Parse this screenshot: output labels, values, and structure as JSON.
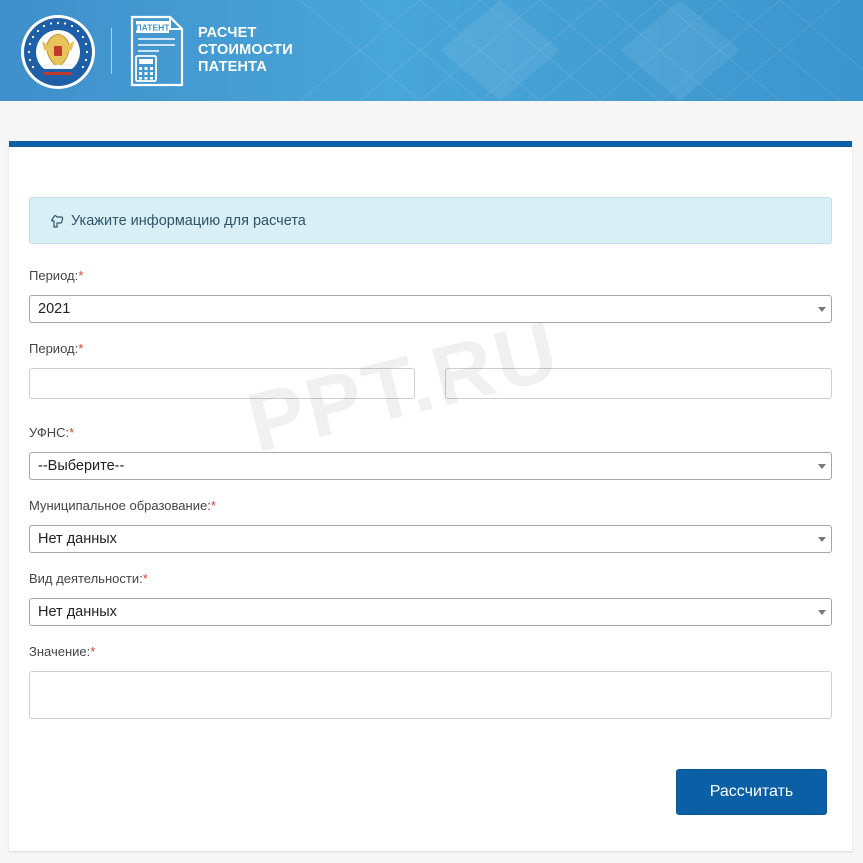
{
  "header": {
    "emblem_ring_text": "ФЕДЕРАЛЬНАЯ НАЛОГОВАЯ СЛУЖБА",
    "patent_badge": "ПАТЕНТ",
    "title_lines": [
      "РАСЧЕТ",
      "СТОИМОСТИ",
      "ПАТЕНТА"
    ]
  },
  "alert": {
    "icon": "hand-pointer-icon",
    "text": "Укажите информацию для расчета"
  },
  "form": {
    "period_year": {
      "label": "Период:",
      "required": "*",
      "value": "2021"
    },
    "period_range": {
      "label": "Период:",
      "required": "*",
      "from": "",
      "to": ""
    },
    "ufns": {
      "label": "УФНС:",
      "required": "*",
      "value": "--Выберите--"
    },
    "municipality": {
      "label": "Муниципальное образование:",
      "required": "*",
      "value": "Нет данных"
    },
    "activity": {
      "label": "Вид деятельности:",
      "required": "*",
      "value": "Нет данных"
    },
    "value_field": {
      "label": "Значение:",
      "required": "*",
      "value": ""
    }
  },
  "submit_label": "Рассчитать",
  "watermark": "PPT.RU",
  "colors": {
    "accent": "#0b5fa5",
    "header_blue": "#49a6d9",
    "alert_bg": "#d9eff6",
    "required": "#d9413a"
  }
}
